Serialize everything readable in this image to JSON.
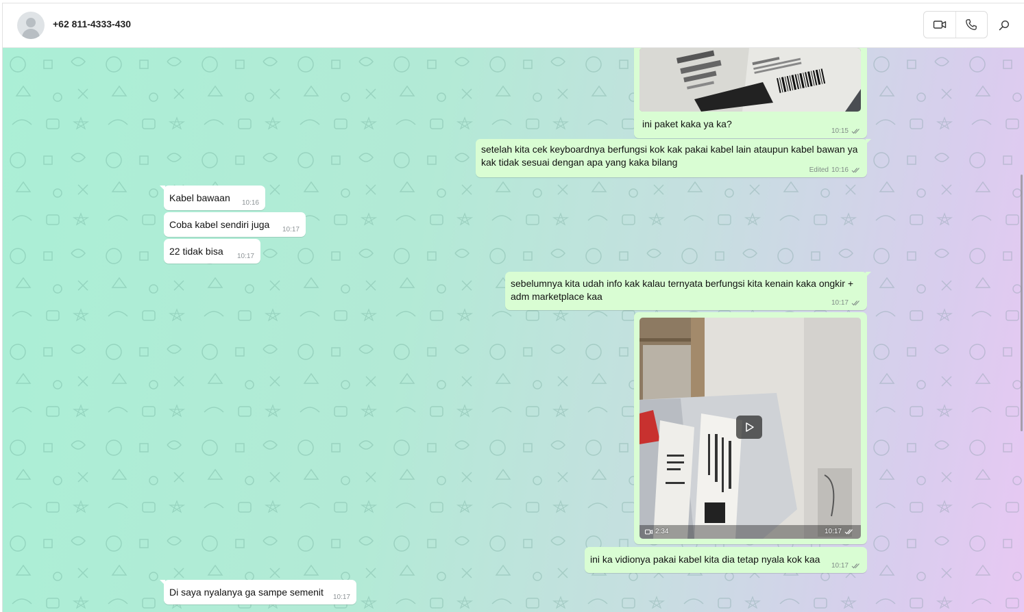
{
  "header": {
    "contact_name": "+62 811-4333-430",
    "icons": [
      "avatar-placeholder",
      "video-call-icon",
      "voice-call-icon",
      "search-icon"
    ]
  },
  "colors": {
    "outgoing_bubble": "#d9fdd3",
    "incoming_bubble": "#ffffff",
    "read_ticks": "#7f8a86"
  },
  "messages": [
    {
      "dir": "out",
      "type": "image",
      "caption": "ini paket kaka ya ka?",
      "time": "10:15",
      "status": "read"
    },
    {
      "dir": "out",
      "type": "text",
      "text": "setelah kita cek keyboardnya berfungsi kok kak pakai kabel lain ataupun kabel bawan ya kak tidak sesuai dengan apa yang kaka bilang",
      "edited_label": "Edited",
      "time": "10:16",
      "status": "read"
    },
    {
      "dir": "in",
      "type": "text",
      "text": "Kabel bawaan",
      "time": "10:16"
    },
    {
      "dir": "in",
      "type": "text",
      "text": "Coba kabel sendiri juga",
      "time": "10:17"
    },
    {
      "dir": "in",
      "type": "text",
      "text": "22 tidak bisa",
      "time": "10:17"
    },
    {
      "dir": "out",
      "type": "text",
      "text": "sebelumnya kita udah info kak kalau ternyata berfungsi kita kenain kaka ongkir + adm marketplace kaa",
      "time": "10:17",
      "status": "read"
    },
    {
      "dir": "out",
      "type": "video",
      "duration": "2:34",
      "time": "10:17",
      "status": "read"
    },
    {
      "dir": "out",
      "type": "text",
      "text": "ini ka vidionya pakai kabel kita dia tetap nyala kok kaa",
      "time": "10:17",
      "status": "read"
    },
    {
      "dir": "in",
      "type": "text",
      "text": "Di saya nyalanya ga sampe semenit",
      "time": "10:17"
    }
  ]
}
